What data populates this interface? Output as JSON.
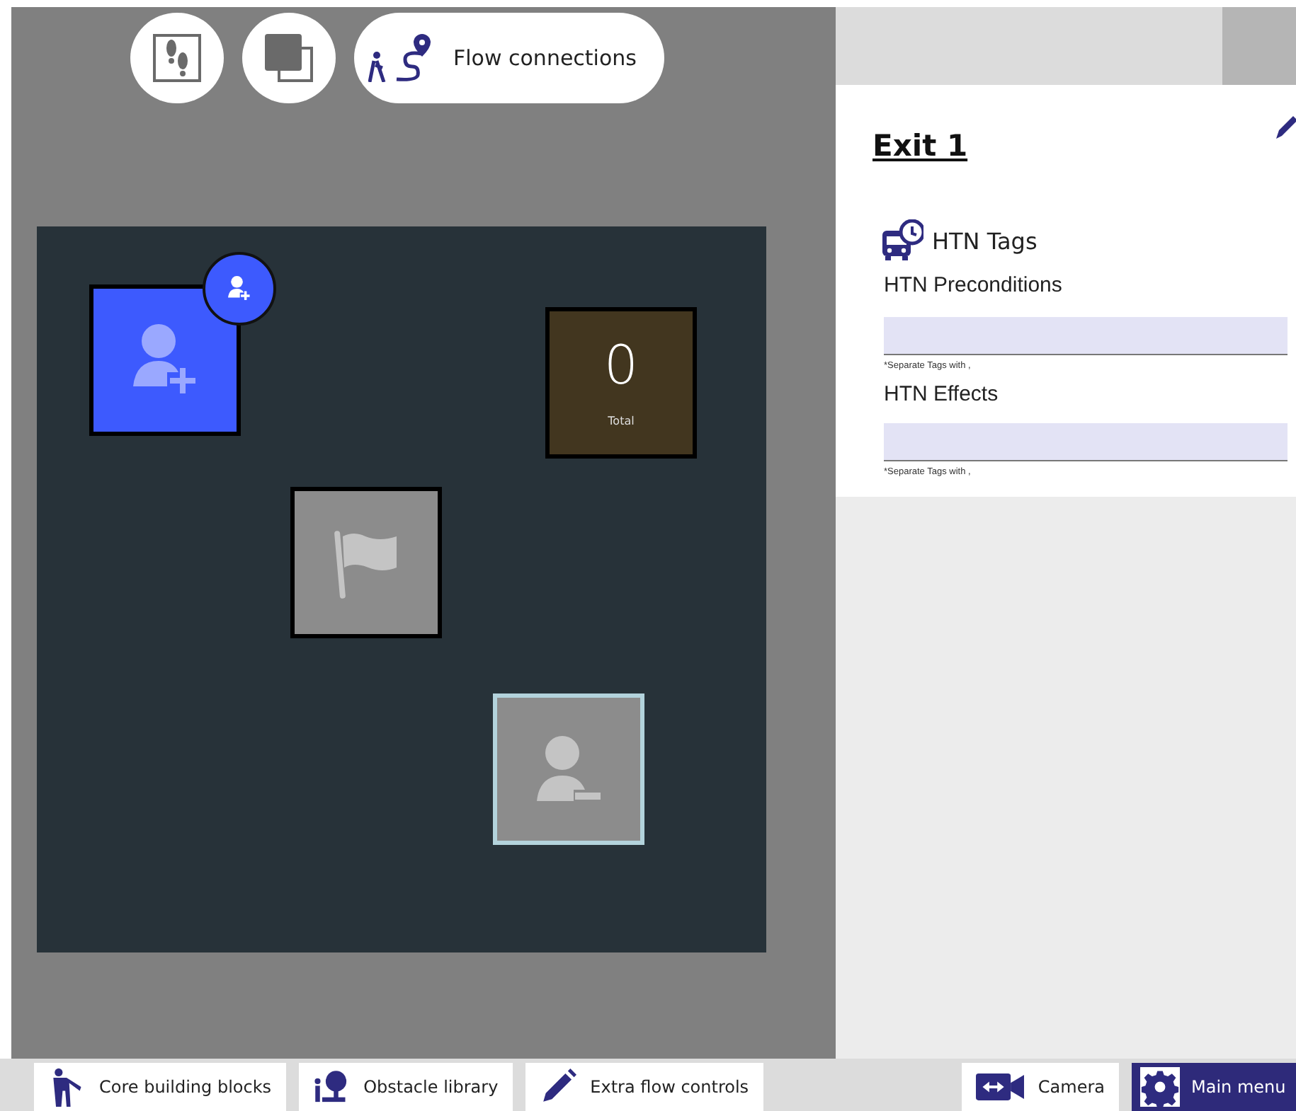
{
  "toolbar": [
    {
      "kind": "footsteps"
    },
    {
      "kind": "layers"
    },
    {
      "kind": "flow",
      "label": "Flow connections"
    }
  ],
  "canvas": {
    "nodes": [
      {
        "kind": "spawn"
      },
      {
        "kind": "counter",
        "value": "0",
        "label": "Total"
      },
      {
        "kind": "goal"
      },
      {
        "kind": "despawn"
      }
    ]
  },
  "inspector": {
    "title": "Exit 1",
    "section": "HTN Tags",
    "fields": [
      {
        "label": "HTN Preconditions",
        "hint": "*Separate Tags with ,"
      },
      {
        "label": "HTN Effects",
        "hint": "*Separate Tags with ,"
      }
    ]
  },
  "bottom_bar": [
    {
      "kind": "tab",
      "label": "Core building blocks"
    },
    {
      "kind": "tab",
      "label": "Obstacle library"
    },
    {
      "kind": "tab",
      "label": "Extra flow controls"
    },
    {
      "kind": "tab",
      "label": "Camera"
    },
    {
      "kind": "menu",
      "label": "Main menu"
    }
  ]
}
